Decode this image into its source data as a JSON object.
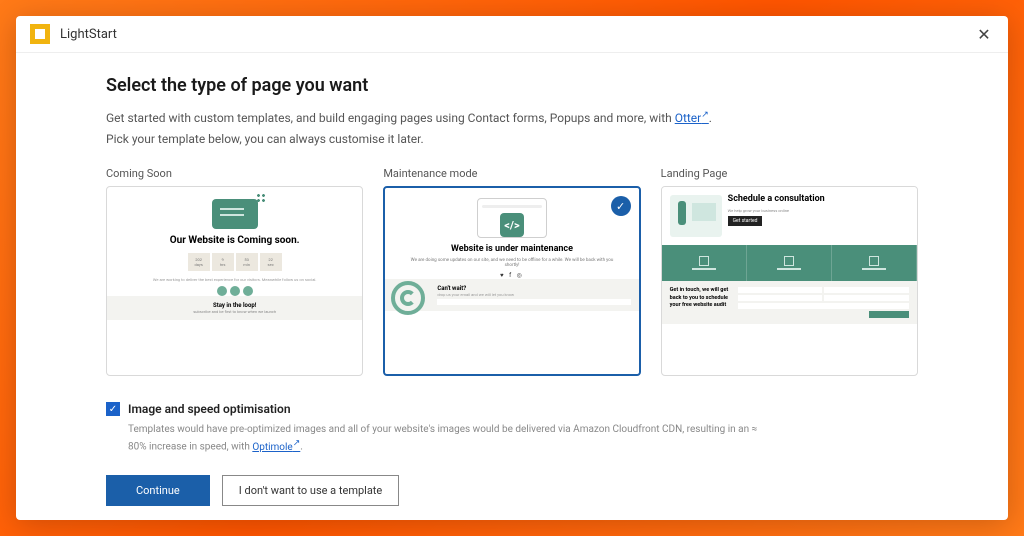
{
  "app": {
    "name": "LightStart"
  },
  "heading": "Select the type of page you want",
  "intro1_a": "Get started with custom templates, and build engaging pages using Contact forms, Popups and more, with ",
  "intro1_link": "Otter",
  "intro2": "Pick your template below, you can always customise it later.",
  "templates": [
    {
      "label": "Coming Soon",
      "selected": false,
      "title": "Our Website is Coming soon.",
      "count": [
        {
          "n": "202",
          "u": "days"
        },
        {
          "n": "9",
          "u": "hrs"
        },
        {
          "n": "53",
          "u": "min"
        },
        {
          "n": "22",
          "u": "sec"
        }
      ],
      "footer": "Stay in the loop!"
    },
    {
      "label": "Maintenance mode",
      "selected": true,
      "title": "Website is under maintenance",
      "sub": "We are doing some updates on our site, and we need to be offline for a while. We will be back with you shortly!",
      "footer": "Can't wait?"
    },
    {
      "label": "Landing Page",
      "selected": false,
      "title": "Schedule a consultation",
      "footer": "Get in touch, we will get back to you to schedule your free website audit"
    }
  ],
  "checkbox": {
    "checked": true,
    "label": "Image and speed optimisation",
    "desc_a": "Templates would have pre-optimized images and all of your website's images would be delivered via Amazon Cloudfront CDN, resulting in an ≈ 80% increase in speed, with ",
    "desc_link": "Optimole"
  },
  "buttons": {
    "primary": "Continue",
    "secondary": "I don't want to use a template"
  }
}
